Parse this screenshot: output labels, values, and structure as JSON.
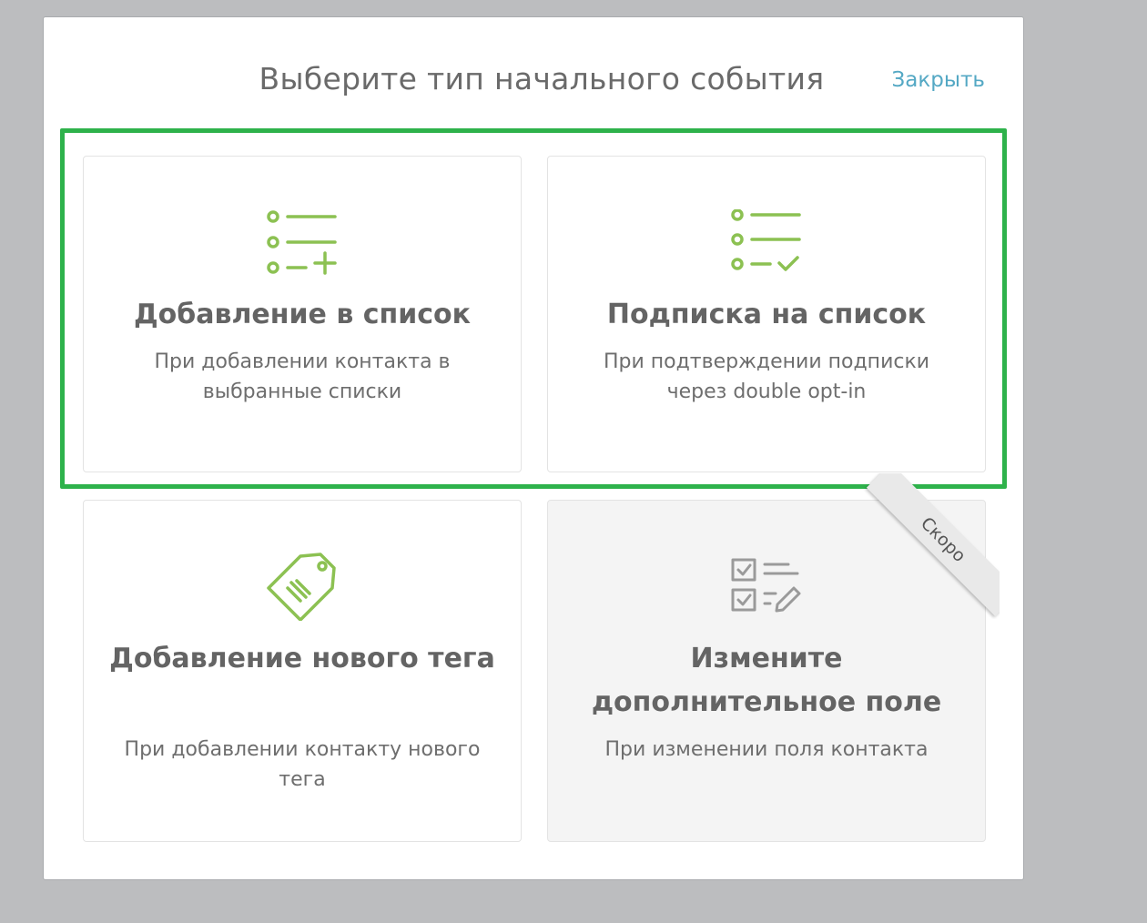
{
  "modal": {
    "title": "Выберите тип начального события",
    "close_label": "Закрыть"
  },
  "cards": [
    {
      "title": "Добавление в список",
      "description": "При добавлении контакта в выбранные списки",
      "icon": "list-add-icon"
    },
    {
      "title": "Подписка на список",
      "description": "При подтверждении подписки через double opt-in",
      "icon": "list-check-icon"
    },
    {
      "title": "Добавление нового тега",
      "description": "При добавлении контакту нового тега",
      "icon": "tag-icon"
    },
    {
      "title": "Измените дополнительное поле",
      "description": "При изменении поля контакта",
      "icon": "checklist-edit-icon",
      "badge": "Скоро",
      "disabled": true
    }
  ],
  "colors": {
    "accent_green": "#8cc152",
    "highlight_green": "#2eb24b",
    "link_blue": "#54a8c4",
    "icon_gray": "#9a9a9a"
  }
}
